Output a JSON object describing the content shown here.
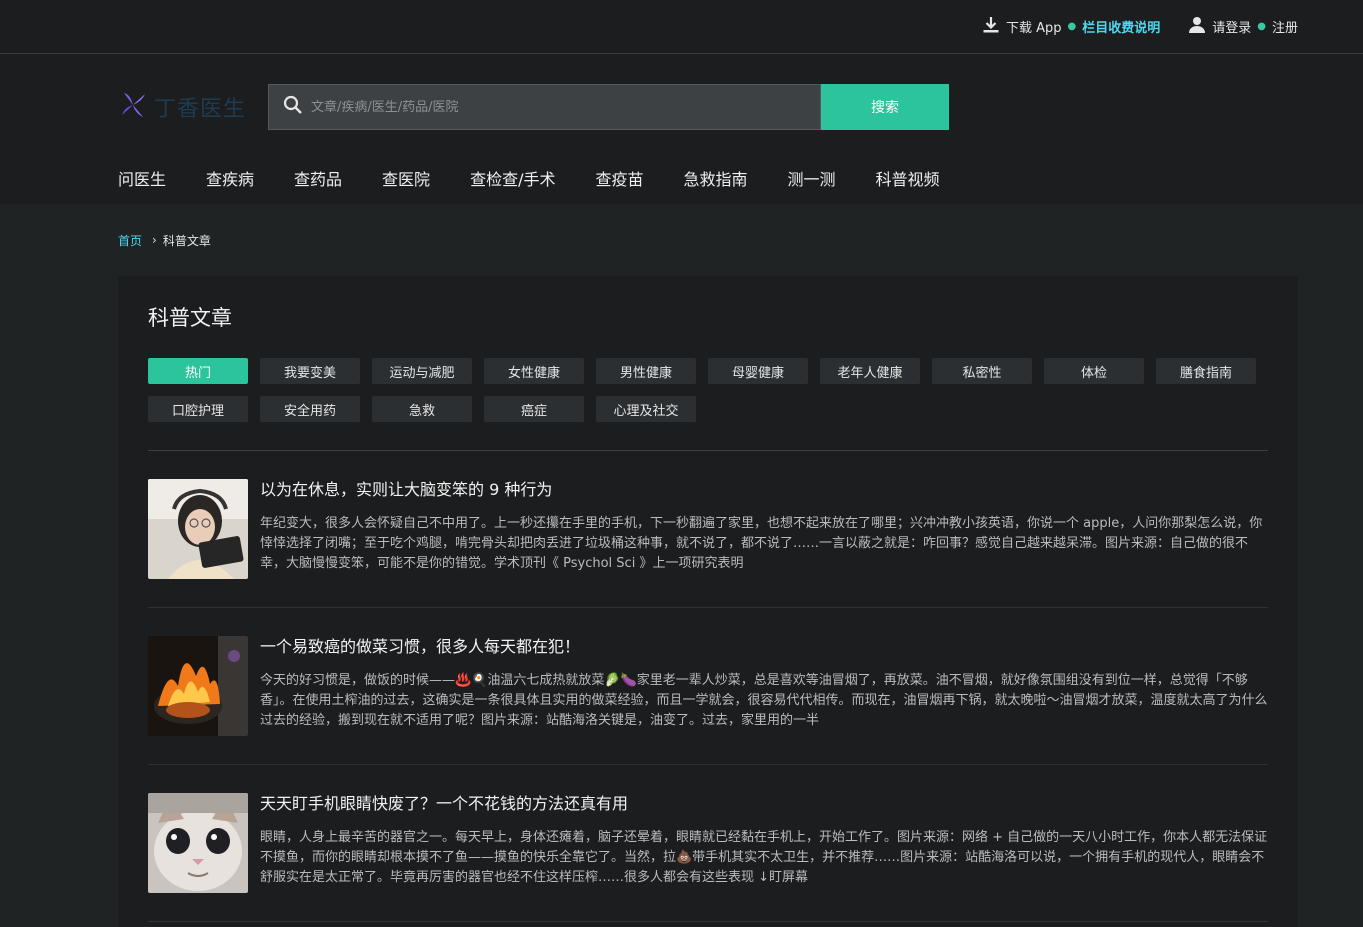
{
  "topbar": {
    "download": "下载 App",
    "column_info": "栏目收费说明",
    "login": "请登录",
    "register": "注册"
  },
  "header": {
    "logo_text": "丁香医生",
    "search_placeholder": "文章/疾病/医生/药品/医院",
    "search_button": "搜索"
  },
  "nav": [
    "问医生",
    "查疾病",
    "查药品",
    "查医院",
    "查检查/手术",
    "查疫苗",
    "急救指南",
    "测一测",
    "科普视频"
  ],
  "breadcrumb": {
    "home": "首页",
    "current": "科普文章"
  },
  "panel": {
    "title": "科普文章",
    "tags": [
      "热门",
      "我要变美",
      "运动与减肥",
      "女性健康",
      "男性健康",
      "母婴健康",
      "老年人健康",
      "私密性",
      "体检",
      "膳食指南",
      "口腔护理",
      "安全用药",
      "急救",
      "癌症",
      "心理及社交"
    ],
    "active_tag": "热门"
  },
  "articles": [
    {
      "title": "以为在休息，实则让大脑变笨的 9 种行为",
      "desc": "年纪变大，很多人会怀疑自己不中用了。上一秒还攥在手里的手机，下一秒翻遍了家里，也想不起来放在了哪里；兴冲冲教小孩英语，你说一个 apple，人问你那梨怎么说，你悻悻选择了闭嘴；至于吃个鸡腿，啃完骨头却把肉丢进了垃圾桶这种事，就不说了，都不说了……一言以蔽之就是：咋回事？感觉自己越来越呆滞。图片来源：自己做的很不幸，大脑慢慢变笨，可能不是你的错觉。学术顶刊《 Psychol Sci 》上一项研究表明"
    },
    {
      "title": "一个易致癌的做菜习惯，很多人每天都在犯！",
      "desc": "今天的好习惯是，做饭的时候——♨️🍳油温六七成热就放菜🥬🍆家里老一辈人炒菜，总是喜欢等油冒烟了，再放菜。油不冒烟，就好像氛围组没有到位一样，总觉得「不够香」。在使用土榨油的过去，这确实是一条很具体且实用的做菜经验，而且一学就会，很容易代代相传。而现在，油冒烟再下锅，就太晚啦～油冒烟才放菜，温度就太高了为什么过去的经验，搬到现在就不适用了呢？图片来源：站酷海洛关键是，油变了。过去，家里用的一半"
    },
    {
      "title": "天天盯手机眼睛快废了？一个不花钱的方法还真有用",
      "desc": "眼睛，人身上最辛苦的器官之一。每天早上，身体还瘫着，脑子还晕着，眼睛就已经黏在手机上，开始工作了。图片来源：网络 + 自己做的一天八小时工作，你本人都无法保证不摸鱼，而你的眼睛却根本摸不了鱼——摸鱼的快乐全靠它了。当然，拉💩带手机其实不太卫生，并不推荐……图片来源：站酷海洛可以说，一个拥有手机的现代人，眼睛会不舒服实在是太正常了。毕竟再厉害的器官也经不住这样压榨……很多人都会有这些表现 ↓盯屏幕"
    }
  ],
  "colors": {
    "accent": "#2bc49c",
    "link": "#4fd7f0",
    "bg": "#202324",
    "panel": "#1b1d1e"
  }
}
